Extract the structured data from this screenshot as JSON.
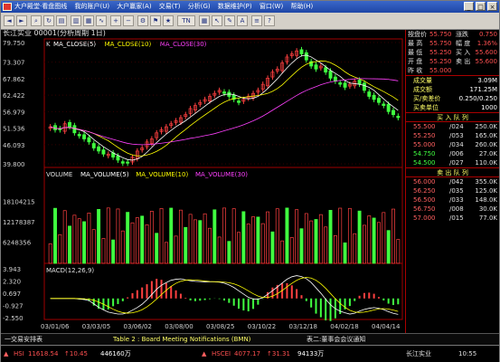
{
  "titlebar": {
    "menus": [
      "大户殿堂·看盘图线",
      "我的账户(U)",
      "大户赢家(A)",
      "交易(T)",
      "分析(G)",
      "数据维护(P)",
      "窗口(W)",
      "帮助(H)"
    ]
  },
  "toolbar": {
    "date_label": "TN"
  },
  "chart": {
    "header": "长江实业 00001(分析周期 1日)",
    "k_label": "K",
    "ma_labels": [
      "MA_CLOSE(5)",
      "MA_CLOSE(10)",
      "MA_CLOSE(30)"
    ],
    "y_ticks": [
      "79.750",
      "73.307",
      "67.862",
      "62.422",
      "56.979",
      "51.536",
      "46.093",
      "39.800"
    ],
    "vol_label": "VOLUME",
    "vol_ma_labels": [
      "MA_VOLUME(5)",
      "MA_VOLUME(10)",
      "MA_VOLUME(30)"
    ],
    "vol_ticks": [
      "18104215",
      "12178387",
      "6248356"
    ],
    "macd_label": "MACD(12,26,9)",
    "macd_ticks": [
      "3.943",
      "2.320",
      "0.697",
      "-0.927",
      "-2.550"
    ],
    "x_ticks": [
      "03/01/06",
      "03/03/05",
      "03/06/02",
      "03/08/00",
      "03/08/25",
      "03/10/22",
      "03/12/18",
      "04/02/18",
      "04/04/14"
    ],
    "close_series": [
      52,
      51,
      51,
      53,
      52,
      50,
      49,
      48,
      47,
      45,
      44,
      43,
      43,
      42,
      41,
      40,
      40,
      42,
      44,
      45,
      47,
      48,
      50,
      51,
      52,
      53,
      54,
      55,
      56,
      58,
      59,
      60,
      61,
      62,
      63,
      64,
      63,
      62,
      61,
      60,
      61,
      62,
      63,
      64,
      66,
      68,
      70,
      71,
      73,
      75,
      76,
      77,
      76,
      74,
      72,
      71,
      72,
      70,
      68,
      67,
      66,
      65,
      66,
      67,
      66,
      64,
      62,
      61,
      60,
      59,
      57,
      56,
      55
    ]
  },
  "panel": {
    "quote_labels": [
      "按盘价",
      "最 高",
      "最 低",
      "开 盘",
      "昨 收"
    ],
    "quote_values": [
      "55.750",
      "55.750",
      "55.250",
      "55.250",
      "55.000"
    ],
    "quote_right_labels": [
      "涨跌",
      "幅 度",
      "买 入",
      "卖 出"
    ],
    "quote_right_values": [
      "0.750",
      "1.36%",
      "55.600",
      "55.600"
    ],
    "stats": [
      {
        "label": "成交量",
        "value": "3.09M"
      },
      {
        "label": "成交额",
        "value": "171.25M"
      },
      {
        "label": "买/卖差价",
        "value": "0.250/0.250"
      },
      {
        "label": "买卖单位",
        "value": "1000"
      }
    ],
    "buy_header": "买 入 队 列",
    "buy_queue": [
      {
        "p": "55.500",
        "n": "/024",
        "q": "250.0K"
      },
      {
        "p": "55.250",
        "n": "/053",
        "q": "165.0K"
      },
      {
        "p": "55.000",
        "n": "/034",
        "q": "260.0K"
      },
      {
        "p": "54.750",
        "n": "/006",
        "q": "27.0K"
      },
      {
        "p": "54.500",
        "n": "/027",
        "q": "110.0K"
      }
    ],
    "sell_header": "卖 出 队 列",
    "sell_queue": [
      {
        "p": "56.000",
        "n": "/042",
        "q": "355.0K"
      },
      {
        "p": "56.250",
        "n": "/035",
        "q": "125.0K"
      },
      {
        "p": "56.500",
        "n": "/033",
        "q": "148.0K"
      },
      {
        "p": "56.750",
        "n": "/008",
        "q": "30.0K"
      },
      {
        "p": "57.000",
        "n": "/015",
        "q": "77.0K"
      }
    ]
  },
  "bottomtabs": {
    "left": "一交易安排表",
    "center": "Table 2 : Board Meeting Notifications (BMN)",
    "right": "表二:董事会会议通知"
  },
  "statusbar": {
    "hsi_label": "HSI",
    "hsi_value": "11618.54",
    "hsi_change": "↑10.45",
    "hsi_turnover": "446160万",
    "hscei_label": "HSCEI",
    "hscei_value": "4077.17",
    "hscei_change": "↑31.31",
    "hscei_turnover": "94133万",
    "stock": "长江实业",
    "time": "10:55"
  },
  "colors": {
    "up": "#ff4040",
    "down": "#40ff40",
    "ma5": "#ffffff",
    "ma10": "#ffff00",
    "ma30": "#ff40ff",
    "axis": "#a00000",
    "panel_yellow": "#ffff66"
  }
}
